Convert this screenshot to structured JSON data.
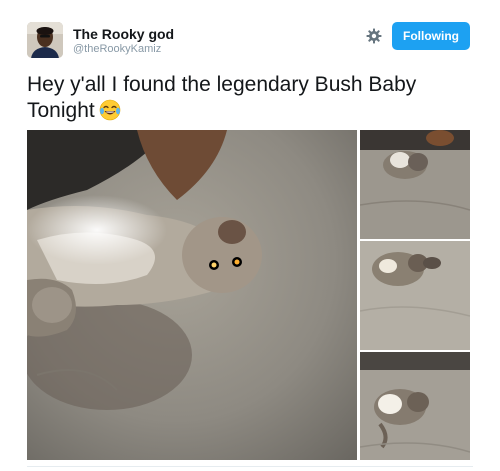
{
  "user": {
    "display_name": "The Rooky god",
    "handle": "@theRookyKamiz"
  },
  "actions": {
    "follow_label": "Following",
    "settings_icon": "gear-icon"
  },
  "tweet": {
    "text": "Hey y'all I found the legendary Bush Baby Tonight",
    "emoji": "face-with-tears-of-joy"
  },
  "media": {
    "photo_count": 4
  },
  "colors": {
    "accent": "#1da1f2",
    "text": "#14171a",
    "muted": "#8899a6"
  }
}
